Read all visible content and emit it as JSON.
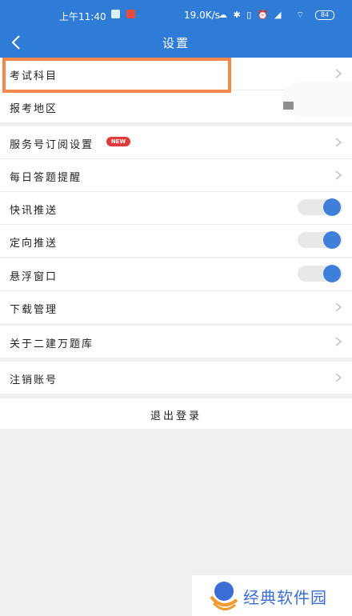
{
  "status_bar": {
    "time": "上午11:40",
    "network_speed": "19.0K/s",
    "battery": "84"
  },
  "header": {
    "title": "设置"
  },
  "groups": [
    {
      "rows": [
        {
          "label": "考试科目",
          "control": "chevron",
          "highlighted": true
        },
        {
          "label": "报考地区",
          "control": "none"
        }
      ]
    },
    {
      "rows": [
        {
          "label": "服务号订阅设置",
          "control": "chevron",
          "badge": "NEW"
        },
        {
          "label": "每日答题提醒",
          "control": "chevron"
        },
        {
          "label": "快讯推送",
          "control": "toggle",
          "on": true
        },
        {
          "label": "定向推送",
          "control": "toggle",
          "on": true
        }
      ]
    },
    {
      "rows": [
        {
          "label": "悬浮窗口",
          "control": "toggle",
          "on": true
        },
        {
          "label": "下载管理",
          "control": "chevron"
        }
      ]
    },
    {
      "rows": [
        {
          "label": "关于二建万题库",
          "control": "chevron"
        }
      ]
    },
    {
      "rows": [
        {
          "label": "注销账号",
          "control": "chevron"
        }
      ]
    }
  ],
  "logout_label": "退出登录",
  "watermark": {
    "text": "经典软件园"
  },
  "colors": {
    "primary": "#2f7cd6",
    "toggle_on": "#3f7fd9",
    "highlight_border": "#f5894c",
    "badge": "#e03b3b"
  }
}
